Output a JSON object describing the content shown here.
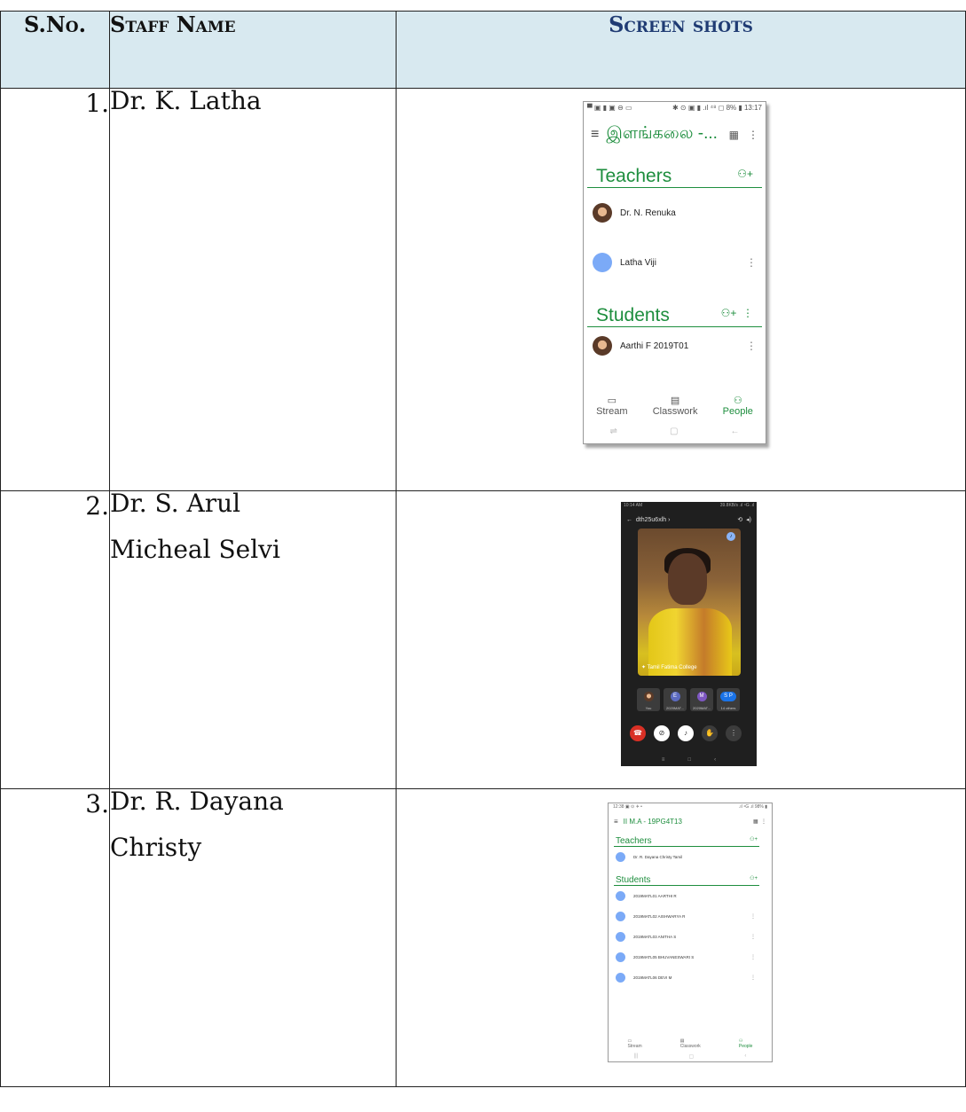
{
  "header": {
    "sno": "S.No.",
    "staff_name": "Staff Name",
    "screen_shots": "Screen shots"
  },
  "rows": [
    {
      "sno": "1.",
      "name_line1": "Dr. K. Latha",
      "name_line2": ""
    },
    {
      "sno": "2.",
      "name_line1": "Dr. S. Arul",
      "name_line2": "Micheal Selvi"
    },
    {
      "sno": "3.",
      "name_line1": "Dr. R. Dayana",
      "name_line2": "Christy"
    }
  ],
  "shot1": {
    "status_left": "▀ ▣ ▮ ▣ ⊖ ▭",
    "status_right": "✱ ⊙ ▣ ▮ .ıl ⁴⁸ ◻ 8% ▮ 13:17",
    "class_title": "இளங்கலை -...",
    "teachers": "Teachers",
    "teacher1": "Dr. N. Renuka",
    "teacher2": "Latha Viji",
    "students": "Students",
    "student1": "Aarthi F 2019T01",
    "nav_stream": "Stream",
    "nav_classwork": "Classwork",
    "nav_people": "People"
  },
  "shot2": {
    "status_left": "10:14 AM",
    "status_right": "39.8KB/s .ıl ⁴G .ıl",
    "meeting_code": "dth25u6xlh ›",
    "caption": "Tamil Fatima College",
    "tile1": "You",
    "tile2": "2020MAT...",
    "tile3": "2020MAT...",
    "tile4": "14 others",
    "tile2_initial": "E",
    "tile3_initial": "M",
    "tile4_initial": "S P"
  },
  "shot3": {
    "status_left": "12:38 ▣ ⊙ ✈ •",
    "status_right": ".ıl ⁴G .ıl 98% ▮",
    "class_title": "II M.A - 19PG4T13",
    "teachers": "Teachers",
    "teacher1": "Dr. R. Dayana Christy Tamil",
    "students": "Students",
    "student1": "2019MATL01 AARTHI R",
    "student2": "2019MATL02 AISHWARYA R",
    "student3": "2019MATL03 ANITHA S",
    "student4": "2019MATL05 BHUVANESWARI S",
    "student5": "2019MATL06 DEVI M",
    "nav_stream": "Stream",
    "nav_classwork": "Classwork",
    "nav_people": "People"
  }
}
